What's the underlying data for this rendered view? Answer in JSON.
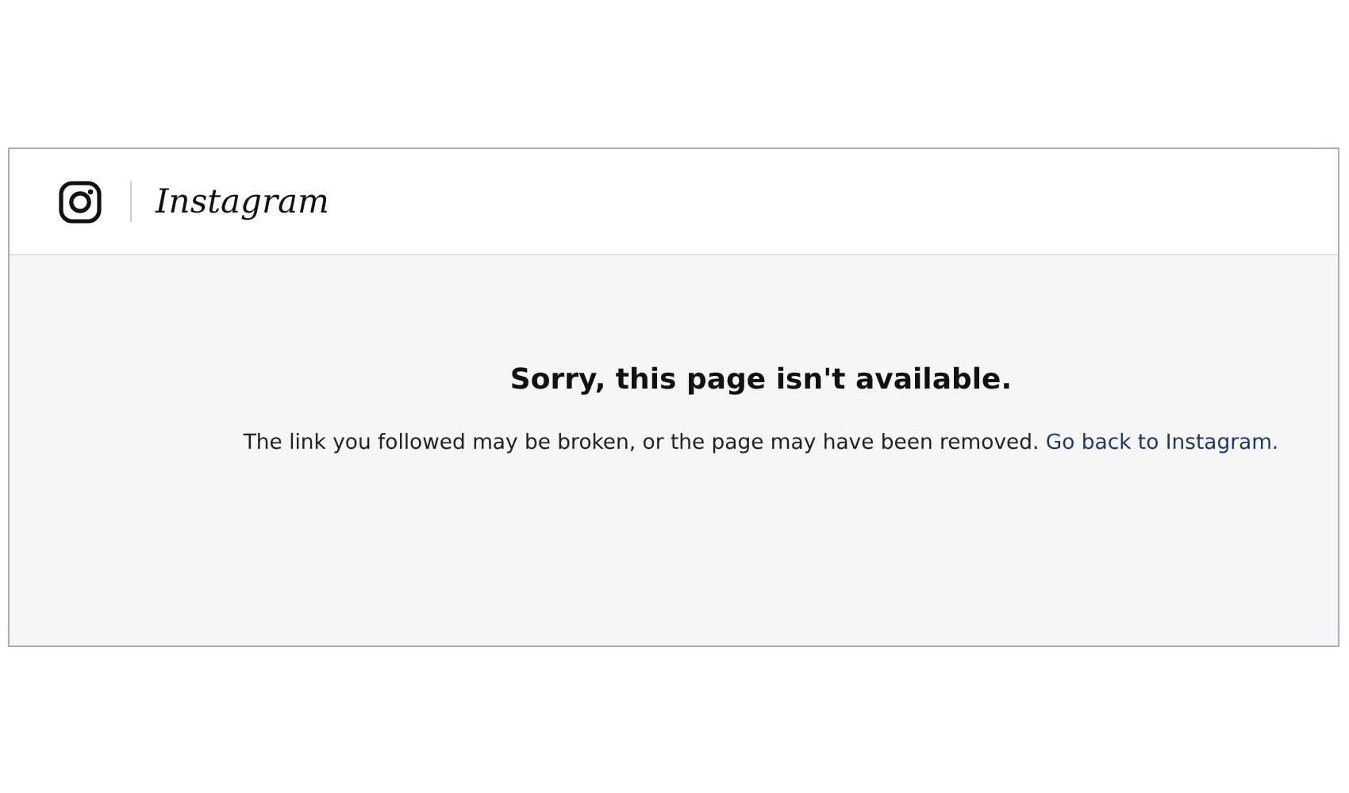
{
  "header": {
    "logo_text": "Instagram"
  },
  "error": {
    "title": "Sorry, this page isn't available.",
    "message": "The link you followed may be broken, or the page may have been removed.",
    "link": "Go back to Instagram."
  }
}
